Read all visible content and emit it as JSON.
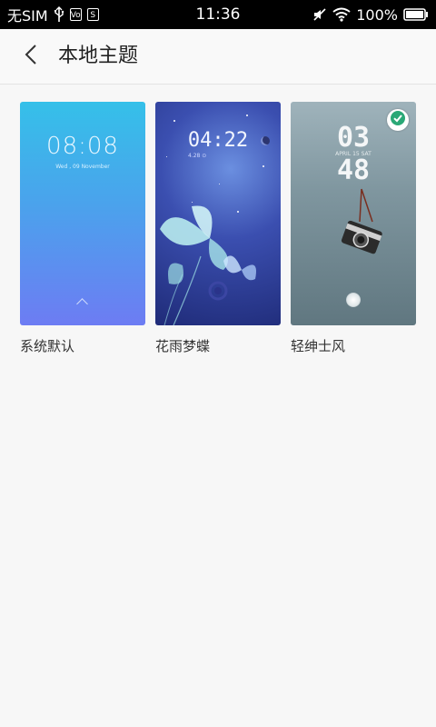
{
  "status_bar": {
    "carrier": "无SIM",
    "time": "11:36",
    "battery": "100%",
    "icons": [
      "usb-icon",
      "vo-icon",
      "s-icon",
      "mute-icon",
      "wifi-icon",
      "battery-icon"
    ]
  },
  "header": {
    "title": "本地主题",
    "back_icon": "chevron-left-icon"
  },
  "themes": [
    {
      "label": "系统默认",
      "clock": "08:08",
      "date": "Wed , 09 November",
      "selected": false
    },
    {
      "label": "花雨梦蝶",
      "clock": "04:22",
      "date": "4.28 ⊙",
      "selected": false
    },
    {
      "label": "轻绅士风",
      "clock_hours": "03",
      "clock_minutes": "48",
      "date": "APRIL 15 SAT",
      "selected": true
    }
  ],
  "colors": {
    "accent": "#2aa876",
    "background": "#f7f7f7",
    "statusbar": "#000000"
  }
}
